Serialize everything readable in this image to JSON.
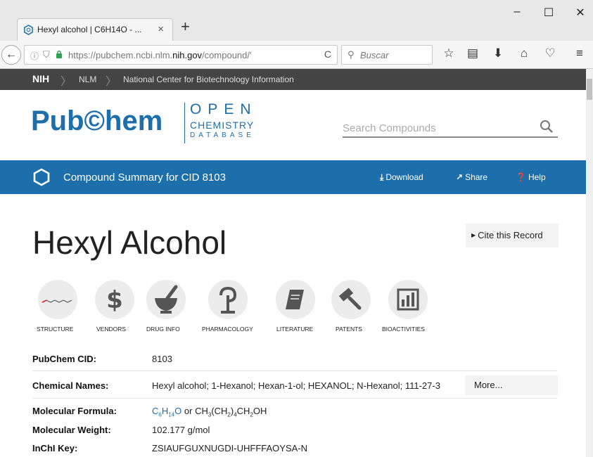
{
  "browser": {
    "tab_title": "Hexyl alcohol | C6H14O - ...",
    "tab_close": "×",
    "new_tab": "+",
    "window_controls": {
      "minimize": "–",
      "maximize": "☐",
      "close": "✕"
    },
    "back": "←",
    "url_prefix": "https://pubchem.ncbi.nlm.",
    "url_domain": "nih.gov",
    "url_suffix": "/compound/'",
    "reload": "C",
    "search_placeholder": "Buscar",
    "toolbar_icons": [
      "star-icon",
      "reader-icon",
      "download-icon",
      "home-icon",
      "pocket-icon",
      "menu-icon"
    ]
  },
  "nih_bar": {
    "items": [
      "NIH",
      "NLM",
      "National Center for Biotechnology Information"
    ]
  },
  "header": {
    "logo_text": "Pub©hem",
    "logo_open": "OPEN",
    "logo_chemistry": "CHEMISTRY",
    "logo_database": "DATABASE",
    "search_placeholder": "Search Compounds"
  },
  "summary_bar": {
    "title": "Compound Summary for CID 8103",
    "download": "Download",
    "share": "Share",
    "help": "Help"
  },
  "compound": {
    "name": "Hexyl Alcohol",
    "cite": "Cite this Record"
  },
  "nav_icons": [
    {
      "label": "STRUCTURE",
      "icon": "structure-icon"
    },
    {
      "label": "VENDORS",
      "icon": "dollar-icon"
    },
    {
      "label": "DRUG INFO",
      "icon": "mortar-pestle-icon"
    },
    {
      "label": "PHARMACOLOGY",
      "icon": "caduceus-icon"
    },
    {
      "label": "LITERATURE",
      "icon": "book-icon"
    },
    {
      "label": "PATENTS",
      "icon": "gavel-icon"
    },
    {
      "label": "BIOACTIVITIES",
      "icon": "bar-chart-icon"
    }
  ],
  "properties": {
    "cid_label": "PubChem CID:",
    "cid_value": "8103",
    "names_label": "Chemical Names:",
    "names_value": "Hexyl alcohol; 1-Hexanol; Hexan-1-ol; HEXANOL; N-Hexanol; 111-27-3",
    "names_more": "More...",
    "formula_label": "Molecular Formula:",
    "formula_c": "C",
    "formula_c_sub": "6",
    "formula_h": "H",
    "formula_h_sub": "14",
    "formula_o": "O",
    "formula_or": "or",
    "formula_alt": "CH",
    "formula_alt_1": "3",
    "formula_alt_2": "(CH",
    "formula_alt_3": "2",
    "formula_alt_4": ")",
    "formula_alt_5": "4",
    "formula_alt_6": "CH",
    "formula_alt_7": "2",
    "formula_alt_8": "OH",
    "weight_label": "Molecular Weight:",
    "weight_value": "102.177 g/mol",
    "inchikey_label": "InChI Key:",
    "inchikey_value": "ZSIAUFGUXNUGDI-UHFFFAOYSA-N"
  },
  "colors": {
    "brand_blue": "#1d6fac",
    "nih_bar": "#444444",
    "chrome": "#e8e8e8"
  }
}
